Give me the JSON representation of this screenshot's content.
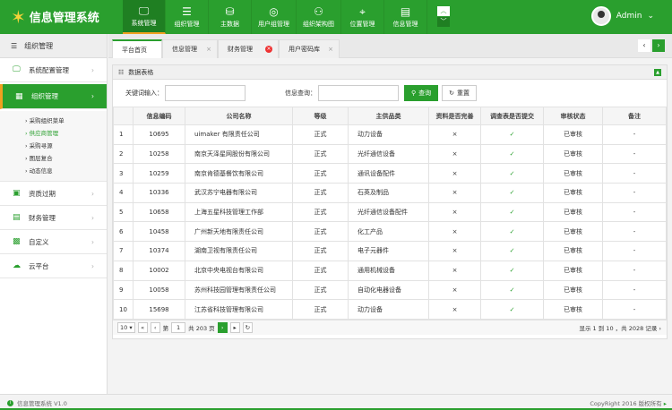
{
  "app": {
    "title": "信息管理系统",
    "user": "Admin",
    "accent": "#2a9f2e"
  },
  "nav": [
    {
      "label": "系统管理",
      "icon": "monitor-icon"
    },
    {
      "label": "组织管理",
      "icon": "list-icon"
    },
    {
      "label": "主数据",
      "icon": "database-icon"
    },
    {
      "label": "用户组管理",
      "icon": "users-icon"
    },
    {
      "label": "组织架构图",
      "icon": "org-icon"
    },
    {
      "label": "位置管理",
      "icon": "location-icon"
    },
    {
      "label": "信息管理",
      "icon": "document-icon"
    }
  ],
  "sidebar": {
    "header": "组织管理",
    "items": [
      {
        "label": "系统配置管理"
      },
      {
        "label": "组织管理"
      },
      {
        "label": "资质过期"
      },
      {
        "label": "财务管理"
      },
      {
        "label": "自定义"
      },
      {
        "label": "云平台"
      }
    ],
    "sub": [
      "采购组织菜单",
      "供应商管理",
      "采购寻源",
      "图层复合",
      "动态信息"
    ]
  },
  "tabs": [
    {
      "label": "平台首页"
    },
    {
      "label": "信息管理"
    },
    {
      "label": "财务管理"
    },
    {
      "label": "用户密码库"
    }
  ],
  "panel": {
    "title": "数据表格",
    "keyword_label": "关键词输入：",
    "keyword_value": "",
    "info_label": "信息查询：",
    "info_value": "",
    "search_btn": "查询",
    "reset_btn": "重置"
  },
  "table": {
    "headers": [
      "",
      "信息编码",
      "公司名称",
      "等级",
      "主供品类",
      "资料是否完善",
      "调查表是否提交",
      "审核状态",
      "备注"
    ],
    "rows": [
      [
        "1",
        "10695",
        "uimaker 有限责任公司",
        "正式",
        "动力设备",
        "×",
        "✓",
        "已审核",
        "-"
      ],
      [
        "2",
        "10258",
        "南京天泽星网股份有限公司",
        "正式",
        "光纤通信设备",
        "×",
        "✓",
        "已审核",
        "-"
      ],
      [
        "3",
        "10259",
        "南京肯德基餐饮有限公司",
        "正式",
        "通讯设备配件",
        "×",
        "✓",
        "已审核",
        "-"
      ],
      [
        "4",
        "10336",
        "武汉苏宁电器有限公司",
        "正式",
        "石英及制品",
        "×",
        "✓",
        "已审核",
        "-"
      ],
      [
        "5",
        "10658",
        "上海五星科技管理工作部",
        "正式",
        "光纤通信设备配件",
        "×",
        "✓",
        "已审核",
        "-"
      ],
      [
        "6",
        "10458",
        "广州新天地有限责任公司",
        "正式",
        "化工产品",
        "×",
        "✓",
        "已审核",
        "-"
      ],
      [
        "7",
        "10374",
        "湖南卫视有限责任公司",
        "正式",
        "电子元器件",
        "×",
        "✓",
        "已审核",
        "-"
      ],
      [
        "8",
        "10002",
        "北京中央电视台有限公司",
        "正式",
        "通用机械设备",
        "×",
        "✓",
        "已审核",
        "-"
      ],
      [
        "9",
        "10058",
        "苏州科技园管理有限责任公司",
        "正式",
        "自动化电器设备",
        "×",
        "✓",
        "已审核",
        "-"
      ],
      [
        "10",
        "15698",
        "江苏省科技管理有限公司",
        "正式",
        "动力设备",
        "×",
        "✓",
        "已审核",
        "-"
      ]
    ]
  },
  "pager": {
    "page_size": "10",
    "page_prefix": "第",
    "page": "1",
    "total_pages": "共 203 页",
    "summary": "显示 1 到 10 ，共 2028 记录"
  },
  "footer": {
    "left": "信息管理系统 V1.0",
    "right": "CopyRight 2016  版权所有"
  }
}
